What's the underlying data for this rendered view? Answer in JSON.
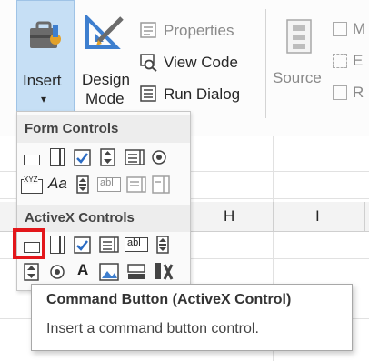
{
  "ribbon": {
    "insert_label": "Insert",
    "insert_caret": "▾",
    "design_label_1": "Design",
    "design_label_2": "Mode",
    "properties_label": "Properties",
    "view_code_label": "View Code",
    "run_dialog_label": "Run Dialog",
    "source_label": "Source",
    "partial_1": "M",
    "partial_2": "E",
    "partial_3": "R"
  },
  "dropdown": {
    "form_controls_title": "Form Controls",
    "activex_title": "ActiveX Controls",
    "label_aa": "Aa",
    "label_xyz": "XYZ",
    "label_abl": "abl",
    "label_a": "A"
  },
  "grid": {
    "col_h": "H",
    "col_i": "I"
  },
  "tooltip": {
    "title": "Command Button (ActiveX Control)",
    "description": "Insert a command button control."
  },
  "colors": {
    "accent": "#c6dff5",
    "highlight": "#e3171b",
    "check": "#2b6cc4"
  }
}
